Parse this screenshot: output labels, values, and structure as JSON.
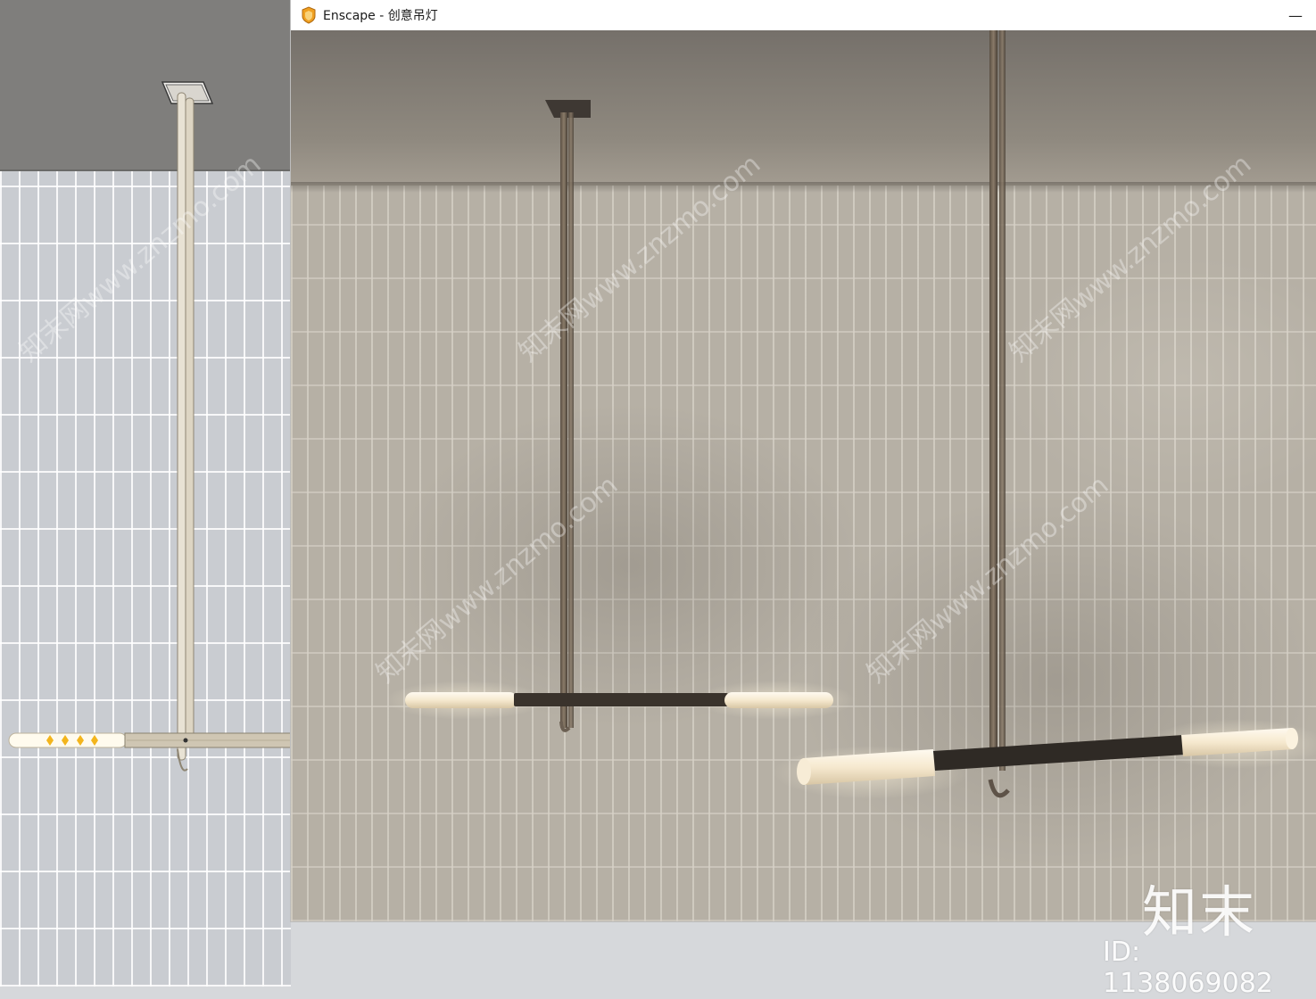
{
  "window": {
    "title": "Enscape - 创意吊灯",
    "minimize_glyph": "—",
    "icon": "enscape-logo-icon",
    "icon_color": "#f0a020"
  },
  "watermark": {
    "logo": "知末",
    "id_text": "ID: 1138069082",
    "diagonal_text": "知末网www.znzmo.com"
  },
  "colors": {
    "ceiling_viewport": "#7f7e7c",
    "tile_viewport": "#c9ccd1",
    "render_wall": "#b6b0a5",
    "render_ceiling": "#75706a",
    "metal_bronze": "#6b5f52",
    "glow": "#fff6e0"
  }
}
